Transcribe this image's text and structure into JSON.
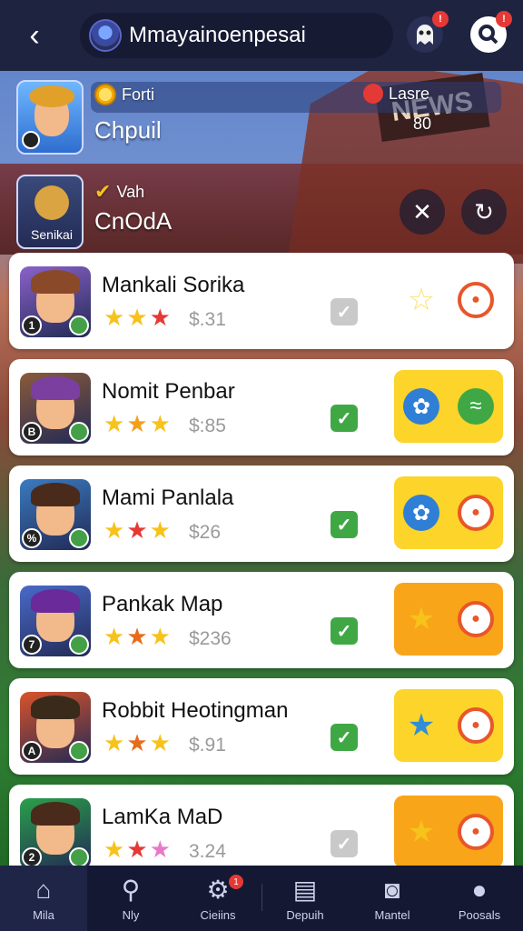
{
  "header": {
    "back_icon": "chevron-left-icon",
    "title": "Mmayainoenpesai",
    "icons": [
      "ghost-icon",
      "search-icon"
    ],
    "badges": [
      "!",
      "!"
    ]
  },
  "banner": {
    "sign_text": "NEWS",
    "featured": [
      {
        "coin_label": "Forti",
        "name": "Chpuil",
        "right_label": "Lasre",
        "right_value": "80"
      },
      {
        "coin_label": "Vah",
        "name": "CnOdA",
        "thumb_caption": "Senikai"
      }
    ],
    "round_buttons": [
      "close-icon",
      "refresh-icon"
    ]
  },
  "list": [
    {
      "name": "Mankali Sorika",
      "price": "$.31",
      "stars": [
        "#f7c21a",
        "#f7c21a",
        "#e53935"
      ],
      "badge": "1",
      "check": "inactive",
      "action_style": "plain",
      "hair": "#8a4a2a",
      "bg": "#8a62c9"
    },
    {
      "name": "Nomit Penbar",
      "price": "$:85",
      "stars": [
        "#f7c21a",
        "#f29f1a",
        "#f7c21a"
      ],
      "badge": "B",
      "check": "active",
      "action_style": "yellow",
      "hair": "#7b3fa0",
      "bg": "#8a5a3a"
    },
    {
      "name": "Mami Panlala",
      "price": "$26",
      "stars": [
        "#f7c21a",
        "#e53935",
        "#f7c21a"
      ],
      "badge": "%",
      "check": "active",
      "action_style": "yellow",
      "hair": "#4a2a1a",
      "bg": "#3a7bc0"
    },
    {
      "name": "Pankak Map",
      "price": "$236",
      "stars": [
        "#f7c21a",
        "#e86a1a",
        "#f7c21a"
      ],
      "badge": "7",
      "check": "active",
      "action_style": "orange",
      "hair": "#6a2a9a",
      "bg": "#4a6ac9"
    },
    {
      "name": "Robbit Heotingman",
      "price": "$.91",
      "stars": [
        "#f7c21a",
        "#e86a1a",
        "#f7c21a"
      ],
      "badge": "A",
      "check": "active",
      "action_style": "yellow",
      "hair": "#3a2a1a",
      "bg": "#d9532a"
    },
    {
      "name": "LamKa MaD",
      "price": "3.24",
      "stars": [
        "#f7c21a",
        "#e53935",
        "#e879c9"
      ],
      "badge": "2",
      "check": "inactive",
      "action_style": "orange",
      "hair": "#4a2a1a",
      "bg": "#2aa04a"
    }
  ],
  "nav": [
    {
      "label": "Mila",
      "icon": "home-icon"
    },
    {
      "label": "Nly",
      "icon": "search-icon"
    },
    {
      "label": "Cieiins",
      "icon": "gear-icon",
      "badge": "1"
    },
    {
      "label": "Depuih",
      "icon": "cards-icon"
    },
    {
      "label": "Mantel",
      "icon": "camera-icon"
    },
    {
      "label": "Poosals",
      "icon": "profile-icon"
    }
  ],
  "colors": {
    "yellow": "#fcd42a",
    "orange": "#f9a51a",
    "check_green": "#3fa845",
    "check_gray": "#c9c9c9"
  }
}
